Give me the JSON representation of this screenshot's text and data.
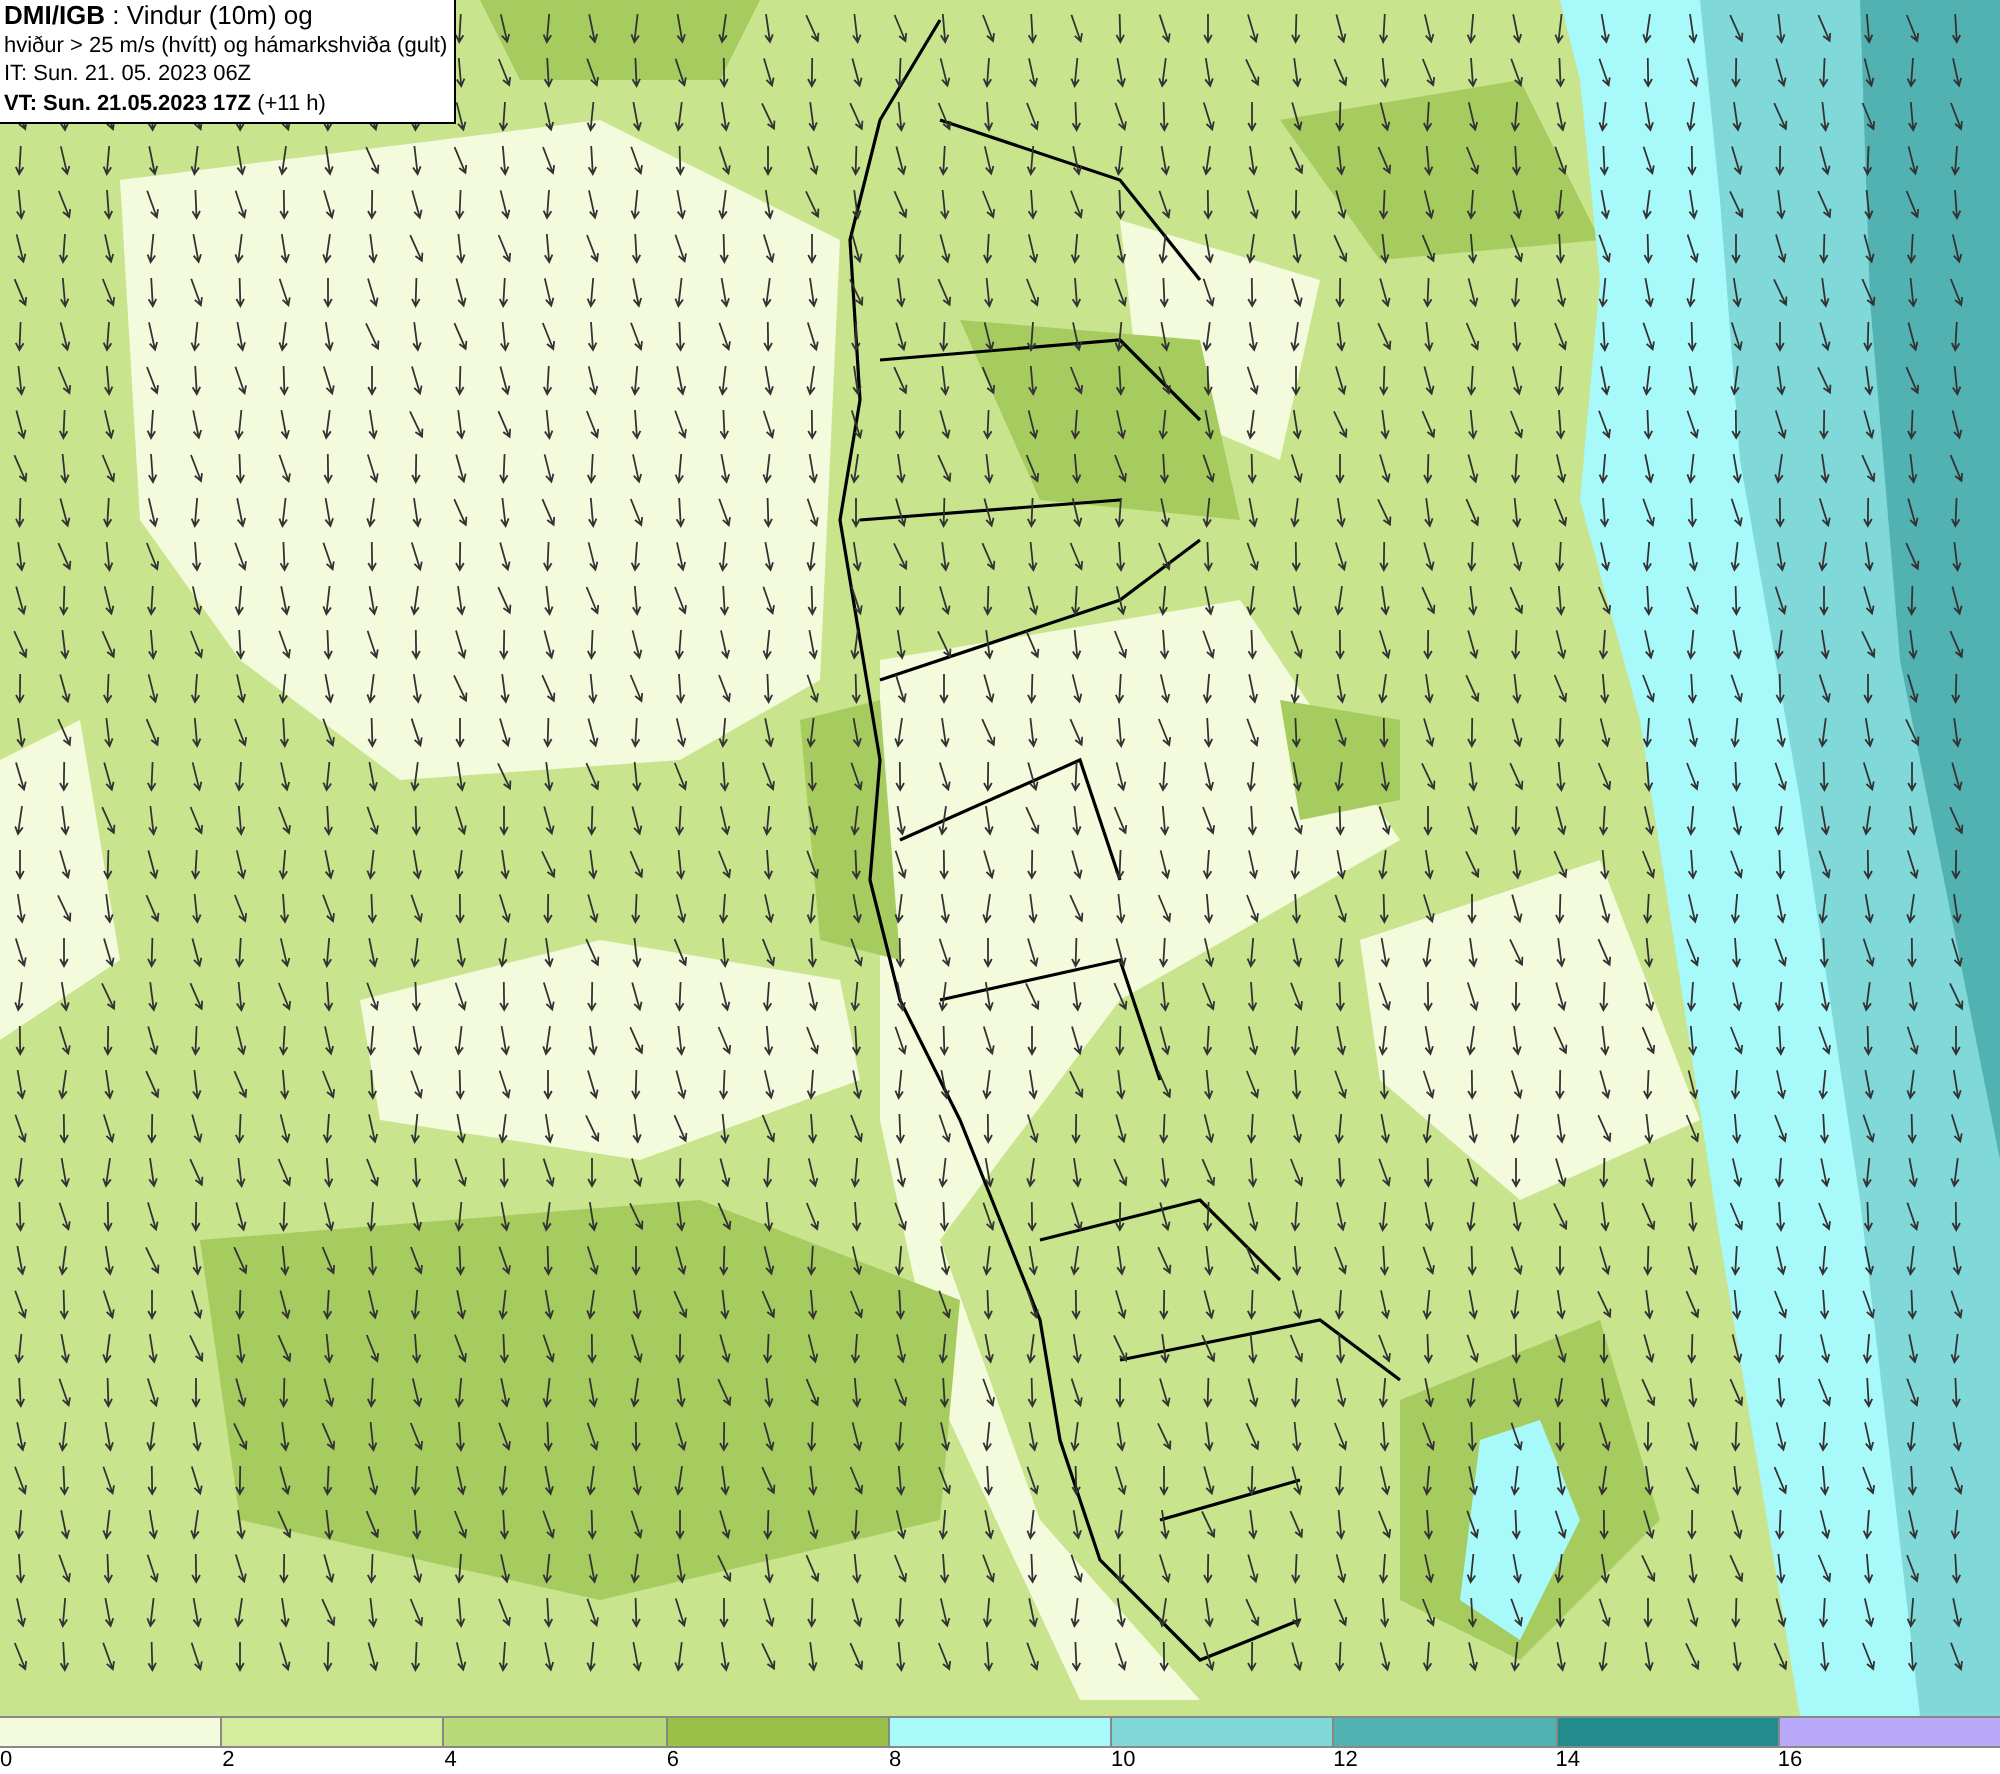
{
  "header": {
    "lines": [
      "**DMI/IGB** : Vindur (10m) og",
      "hviður > 25 m/s (hvítt) og hámarkshviða (gult)",
      "IT: Sun. 21. 05. 2023 06Z",
      "**VT: Sun. 21.05.2023 17Z** (+11 h)"
    ]
  },
  "colorbar": {
    "segments": [
      {
        "color": "#f4fadc"
      },
      {
        "color": "#d4ec9c"
      },
      {
        "color": "#b8da78"
      },
      {
        "color": "#9bc048"
      },
      {
        "color": "#a8fafa"
      },
      {
        "color": "#80d8d8"
      },
      {
        "color": "#52b2b2"
      },
      {
        "color": "#228c8c"
      },
      {
        "color": "#baa8f8"
      }
    ],
    "ticks": [
      "0",
      "2",
      "4",
      "6",
      "8",
      "10",
      "12",
      "14",
      "16"
    ]
  }
}
